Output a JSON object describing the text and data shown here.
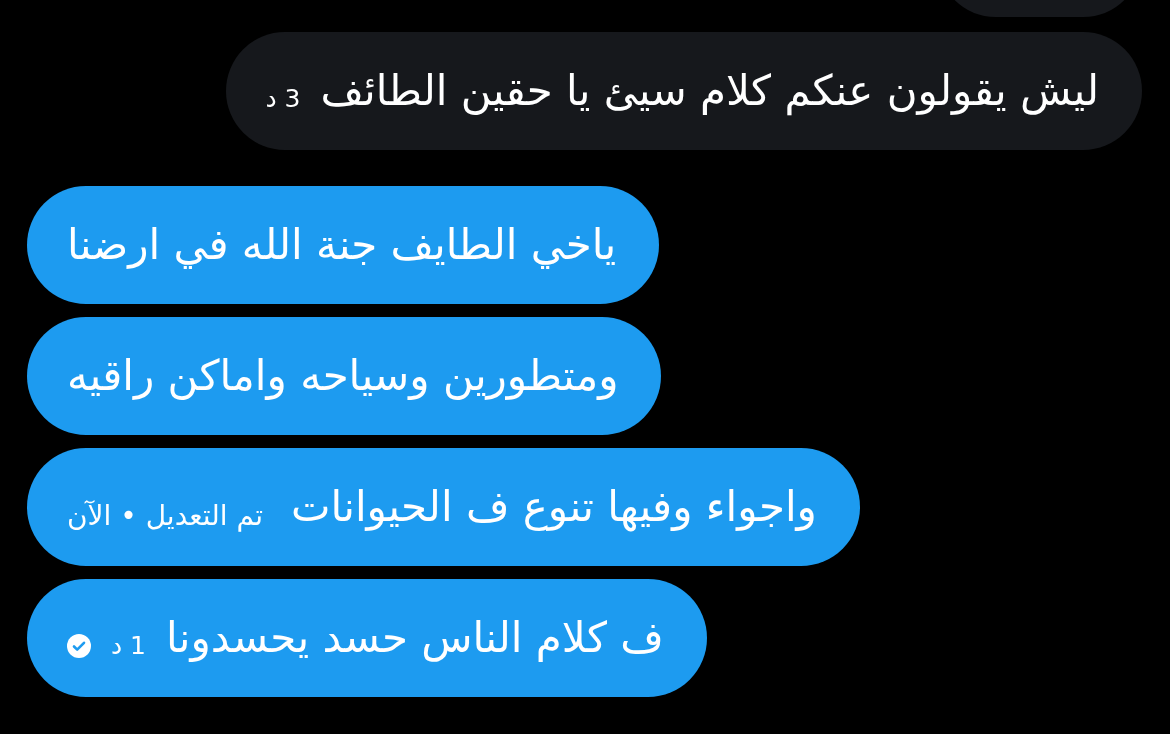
{
  "messages": [
    {
      "kind": "received",
      "text": "ليش يقولون عنكم كلام سيئ يا حقين الطائف",
      "time": "3 د"
    },
    {
      "kind": "sent",
      "text": "ياخي الطايف جنة الله في ارضنا"
    },
    {
      "kind": "sent",
      "text": "ومتطورين وسياحه واماكن راقيه"
    },
    {
      "kind": "sent",
      "text": "واجواء وفيها تنوع ف الحيوانات",
      "edited_note": "تم التعديل • الآن"
    },
    {
      "kind": "sent",
      "text": "ف كلام الناس حسد يحسدونا",
      "time": "1 د",
      "seen": true
    }
  ]
}
